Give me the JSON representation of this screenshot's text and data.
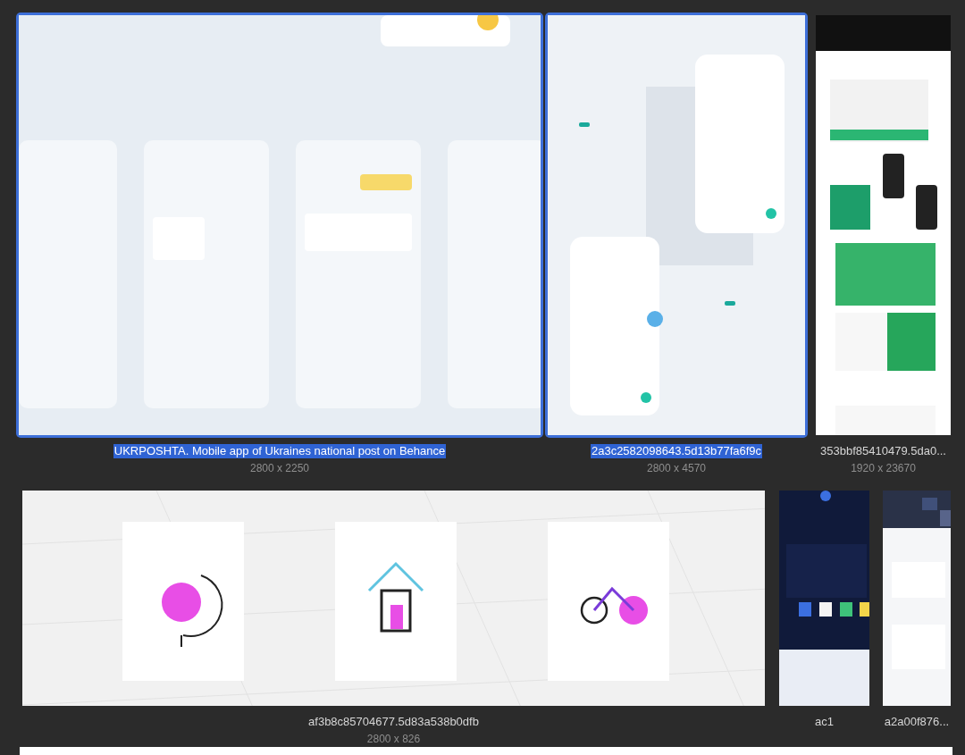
{
  "rows": [
    {
      "items": [
        {
          "title": "UKRPOSHTA. Mobile app of Ukraines national post on Behance",
          "size": "2800 x 2250",
          "selected": true,
          "kind": "cards"
        },
        {
          "title": "2a3c2582098643.5d13b77fa6f9c",
          "size": "2800 x 4570",
          "selected": true,
          "kind": "phones"
        },
        {
          "title": "353bbf85410479.5da0...",
          "size": "1920 x 23670",
          "selected": false,
          "kind": "green"
        }
      ]
    },
    {
      "items": [
        {
          "title": "af3b8c85704677.5d83a538b0dfb",
          "size": "2800 x 826",
          "selected": false,
          "kind": "icons"
        },
        {
          "title": "ac1",
          "selected": false,
          "kind": "dark"
        },
        {
          "title": "a2a00f876...",
          "selected": false,
          "kind": "light"
        }
      ]
    }
  ]
}
